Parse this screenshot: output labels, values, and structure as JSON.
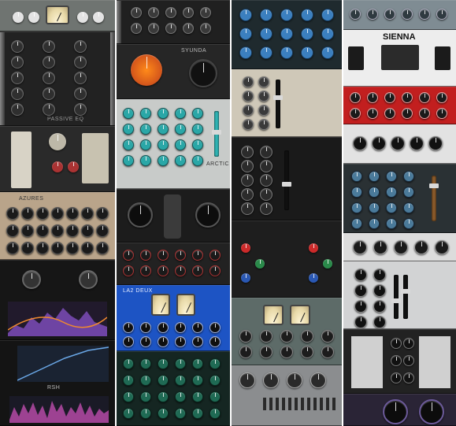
{
  "collage": {
    "columns": [
      {
        "name": "column-1",
        "panels": [
          {
            "name": "tube-meter-unit",
            "bg": "#6f7471",
            "label": ""
          },
          {
            "name": "passive-eq-dark",
            "bg": "#222222",
            "label": "PASSIVE EQ"
          },
          {
            "name": "channel-strip-cream",
            "bg": "#2a2a2a",
            "label": ""
          },
          {
            "name": "eq-beige-grid",
            "bg": "#b9a48a",
            "label": "AZURES"
          },
          {
            "name": "dynamic-eq-plugin",
            "bg": "#161616",
            "label": ""
          },
          {
            "name": "spectrum-analyzer-plugin",
            "bg": "#141414",
            "label": "RSH"
          }
        ]
      },
      {
        "name": "column-2",
        "panels": [
          {
            "name": "dark-compressor-top",
            "bg": "#202020",
            "label": ""
          },
          {
            "name": "orange-meter-unit",
            "bg": "#262626",
            "label": "SYUNDA"
          },
          {
            "name": "silver-eq-teal",
            "bg": "#c8cbc9",
            "label": "ARCTIC"
          },
          {
            "name": "tube-mic-preamp",
            "bg": "#1c1c1c",
            "label": ""
          },
          {
            "name": "red-dark-eq",
            "bg": "#222222",
            "label": ""
          },
          {
            "name": "blue-vu-compressor",
            "bg": "#1d54c4",
            "label": "LA2 DEUX"
          },
          {
            "name": "green-eq-rack",
            "bg": "#152622",
            "label": ""
          }
        ]
      },
      {
        "name": "column-3",
        "panels": [
          {
            "name": "teal-console-eq",
            "bg": "#1f2a2e",
            "label": ""
          },
          {
            "name": "cream-fader-strip",
            "bg": "#cfc8b8",
            "label": ""
          },
          {
            "name": "black-mastering-eq",
            "bg": "#1a1a1a",
            "label": ""
          },
          {
            "name": "colored-knob-eq",
            "bg": "#1e1e1e",
            "label": ""
          },
          {
            "name": "grey-vu-leveler",
            "bg": "#5d6b68",
            "label": ""
          },
          {
            "name": "steel-patchbay",
            "bg": "#8b8d8f",
            "label": ""
          }
        ]
      },
      {
        "name": "column-4",
        "panels": [
          {
            "name": "blue-grey-strip",
            "bg": "#7f8c93",
            "label": ""
          },
          {
            "name": "studio-monitors-ad",
            "bg": "#ededed",
            "label": "SIENNA"
          },
          {
            "name": "red-compressor",
            "bg": "#c21f1f",
            "label": ""
          },
          {
            "name": "white-tube-eq",
            "bg": "#e2e2e2",
            "label": ""
          },
          {
            "name": "teal-channel-strip",
            "bg": "#2a3134",
            "label": ""
          },
          {
            "name": "white-compressor",
            "bg": "#dcdcdc",
            "label": ""
          },
          {
            "name": "silver-eq-faders",
            "bg": "#d2d3d4",
            "label": ""
          },
          {
            "name": "dark-panel-meters",
            "bg": "#222222",
            "label": ""
          },
          {
            "name": "purple-mastering-unit",
            "bg": "#2a2436",
            "label": ""
          }
        ]
      }
    ]
  }
}
